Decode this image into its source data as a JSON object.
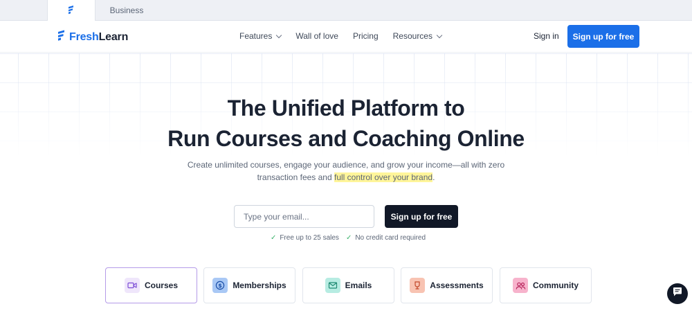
{
  "top_tabs": [
    {
      "label": "",
      "icon": "freshlearn-logo-icon",
      "active": true
    },
    {
      "label": "Business",
      "active": false
    }
  ],
  "nav": {
    "logo": {
      "part1": "Fresh",
      "part2": "Learn"
    },
    "links": [
      {
        "label": "Features",
        "has_dropdown": true
      },
      {
        "label": "Wall of love",
        "has_dropdown": false
      },
      {
        "label": "Pricing",
        "has_dropdown": false
      },
      {
        "label": "Resources",
        "has_dropdown": true
      }
    ],
    "signin_label": "Sign in",
    "signup_label": "Sign up for free"
  },
  "hero": {
    "title_line1": "The Unified Platform to",
    "title_line2": "Run Courses and Coaching Online",
    "subtitle_part1": "Create unlimited courses, engage your audience, and grow your income—all with zero transaction fees and ",
    "subtitle_highlight": "full control over your brand",
    "subtitle_end": "."
  },
  "form": {
    "email_placeholder": "Type your email...",
    "email_value": "",
    "submit_label": "Sign up for free",
    "perks": [
      "Free up to 25 sales",
      "No credit card required"
    ]
  },
  "features": [
    {
      "label": "Courses",
      "icon": "video-icon",
      "icon_bg": "#efe6fb",
      "icon_color": "#7c4dd6",
      "active": true
    },
    {
      "label": "Memberships",
      "icon": "dollar-icon",
      "icon_bg": "#a9c8f5",
      "icon_color": "#1b4fa8",
      "active": false
    },
    {
      "label": "Emails",
      "icon": "mail-icon",
      "icon_bg": "#b7ece2",
      "icon_color": "#1e8a72",
      "active": false
    },
    {
      "label": "Assessments",
      "icon": "trophy-icon",
      "icon_bg": "#f8c3b2",
      "icon_color": "#c2482a",
      "active": false
    },
    {
      "label": "Community",
      "icon": "users-icon",
      "icon_bg": "#f7b3cc",
      "icon_color": "#b8265d",
      "active": false
    }
  ],
  "colors": {
    "brand_blue": "#1b6fe8",
    "dark_button": "#111827",
    "highlight": "#fff59a",
    "check_green": "#3ab26a"
  }
}
